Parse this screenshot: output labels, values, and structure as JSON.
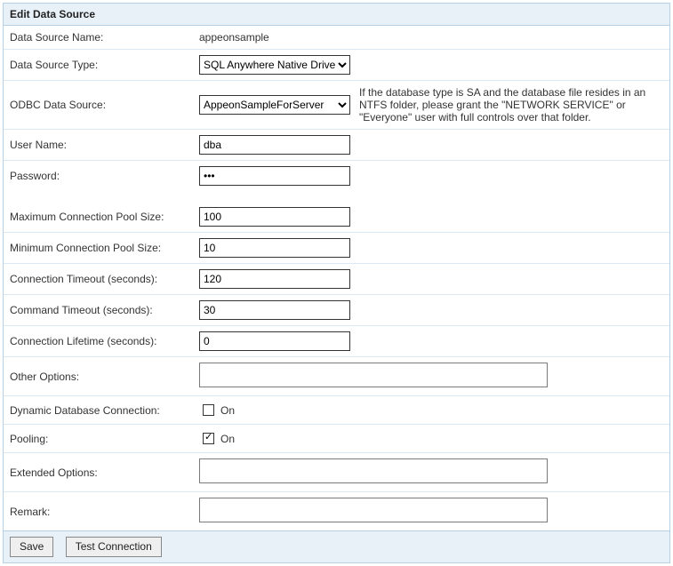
{
  "title": "Edit Data Source",
  "labels": {
    "dataSourceName": "Data Source Name:",
    "dataSourceType": "Data Source Type:",
    "odbcDataSource": "ODBC Data Source:",
    "userName": "User Name:",
    "password": "Password:",
    "maxPool": "Maximum Connection Pool Size:",
    "minPool": "Minimum Connection Pool Size:",
    "connTimeout": "Connection Timeout (seconds):",
    "cmdTimeout": "Command Timeout (seconds):",
    "connLifetime": "Connection Lifetime (seconds):",
    "otherOptions": "Other Options:",
    "dynamicDb": "Dynamic Database Connection:",
    "pooling": "Pooling:",
    "extendedOptions": "Extended Options:",
    "remark": "Remark:"
  },
  "values": {
    "dataSourceName": "appeonsample",
    "dataSourceType": "SQL Anywhere Native Driver",
    "odbcDataSource": "AppeonSampleForServer",
    "userName": "dba",
    "password": "•••",
    "maxPool": "100",
    "minPool": "10",
    "connTimeout": "120",
    "cmdTimeout": "30",
    "connLifetime": "0",
    "otherOptions": "",
    "extendedOptions": "",
    "remark": ""
  },
  "checkboxes": {
    "dynamicDbOnLabel": "On",
    "poolingOnLabel": "On"
  },
  "notes": {
    "odbc": "If the database type is SA and the database file resides in an NTFS folder, please grant the \"NETWORK SERVICE\" or \"Everyone\" user with full controls over that folder."
  },
  "buttons": {
    "save": "Save",
    "test": "Test Connection"
  }
}
